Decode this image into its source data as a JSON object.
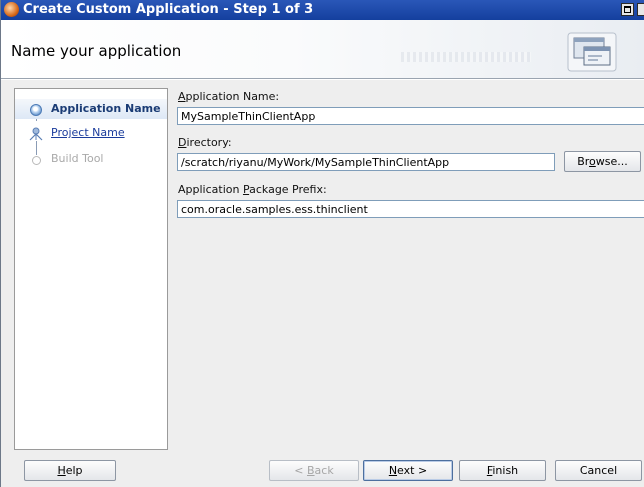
{
  "window": {
    "title": "Create Custom Application - Step 1 of 3"
  },
  "header": {
    "title": "Name your application",
    "icon": "application-window-icon"
  },
  "nav": {
    "steps": [
      {
        "label": "Application Name",
        "state": "current",
        "icon": "current-step-icon"
      },
      {
        "label": "Project Name",
        "state": "link",
        "icon": "project-step-icon"
      },
      {
        "label": "Build Tool",
        "state": "disabled",
        "icon": "pending-step-icon"
      }
    ]
  },
  "form": {
    "app_name": {
      "label_mnemonic": "A",
      "label_rest": "pplication Name:",
      "value": "MySampleThinClientApp"
    },
    "directory": {
      "label_mnemonic": "D",
      "label_rest": "irectory:",
      "value": "/scratch/riyanu/MyWork/MySampleThinClientApp"
    },
    "browse": {
      "pre": "Br",
      "mnemonic": "o",
      "post": "wse..."
    },
    "package": {
      "label_pre": "Application ",
      "label_mnemonic": "P",
      "label_rest": "ackage Prefix:",
      "value": "com.oracle.samples.ess.thinclient"
    }
  },
  "footer": {
    "help": {
      "mnemonic": "H",
      "rest": "elp"
    },
    "back": {
      "pre": "< ",
      "mnemonic": "B",
      "rest": "ack"
    },
    "next": {
      "mnemonic": "N",
      "rest": "ext >"
    },
    "finish": {
      "mnemonic": "F",
      "rest": "inish"
    },
    "cancel": "Cancel"
  },
  "colors": {
    "titlebar": "#1d4aaa",
    "link": "#1b3c9c",
    "current_step": "#1b3c75"
  }
}
